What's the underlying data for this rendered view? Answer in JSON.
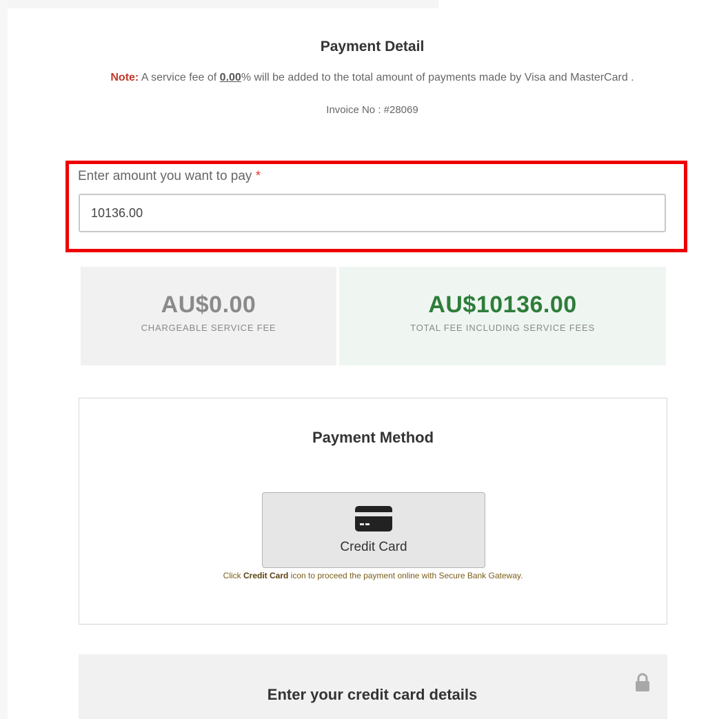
{
  "header": {
    "title": "Payment Detail",
    "note_label": "Note:",
    "note_prefix": " A service fee of ",
    "note_percent": "0.00",
    "note_suffix": "% will be added to the total amount of payments made by Visa and MasterCard .",
    "invoice": "Invoice No : #28069"
  },
  "amount": {
    "label": "Enter amount you want to pay",
    "required_mark": "*",
    "value": "10136.00"
  },
  "fees": {
    "service_fee_value": "AU$0.00",
    "service_fee_caption": "CHARGEABLE SERVICE FEE",
    "total_fee_value": "AU$10136.00",
    "total_fee_caption": "TOTAL FEE INCLUDING SERVICE FEES"
  },
  "payment_method": {
    "title": "Payment Method",
    "credit_card_label": "Credit Card",
    "hint_prefix": "Click ",
    "hint_bold": "Credit Card",
    "hint_suffix": " icon to proceed the payment online with Secure Bank Gateway."
  },
  "card_details": {
    "title": "Enter your credit card details"
  },
  "colors": {
    "highlight": "#ee0000",
    "total_fee": "#2e7d3a",
    "note_label": "#c0392b"
  },
  "icons": {
    "credit_card": "credit-card-icon",
    "lock": "lock-icon"
  }
}
